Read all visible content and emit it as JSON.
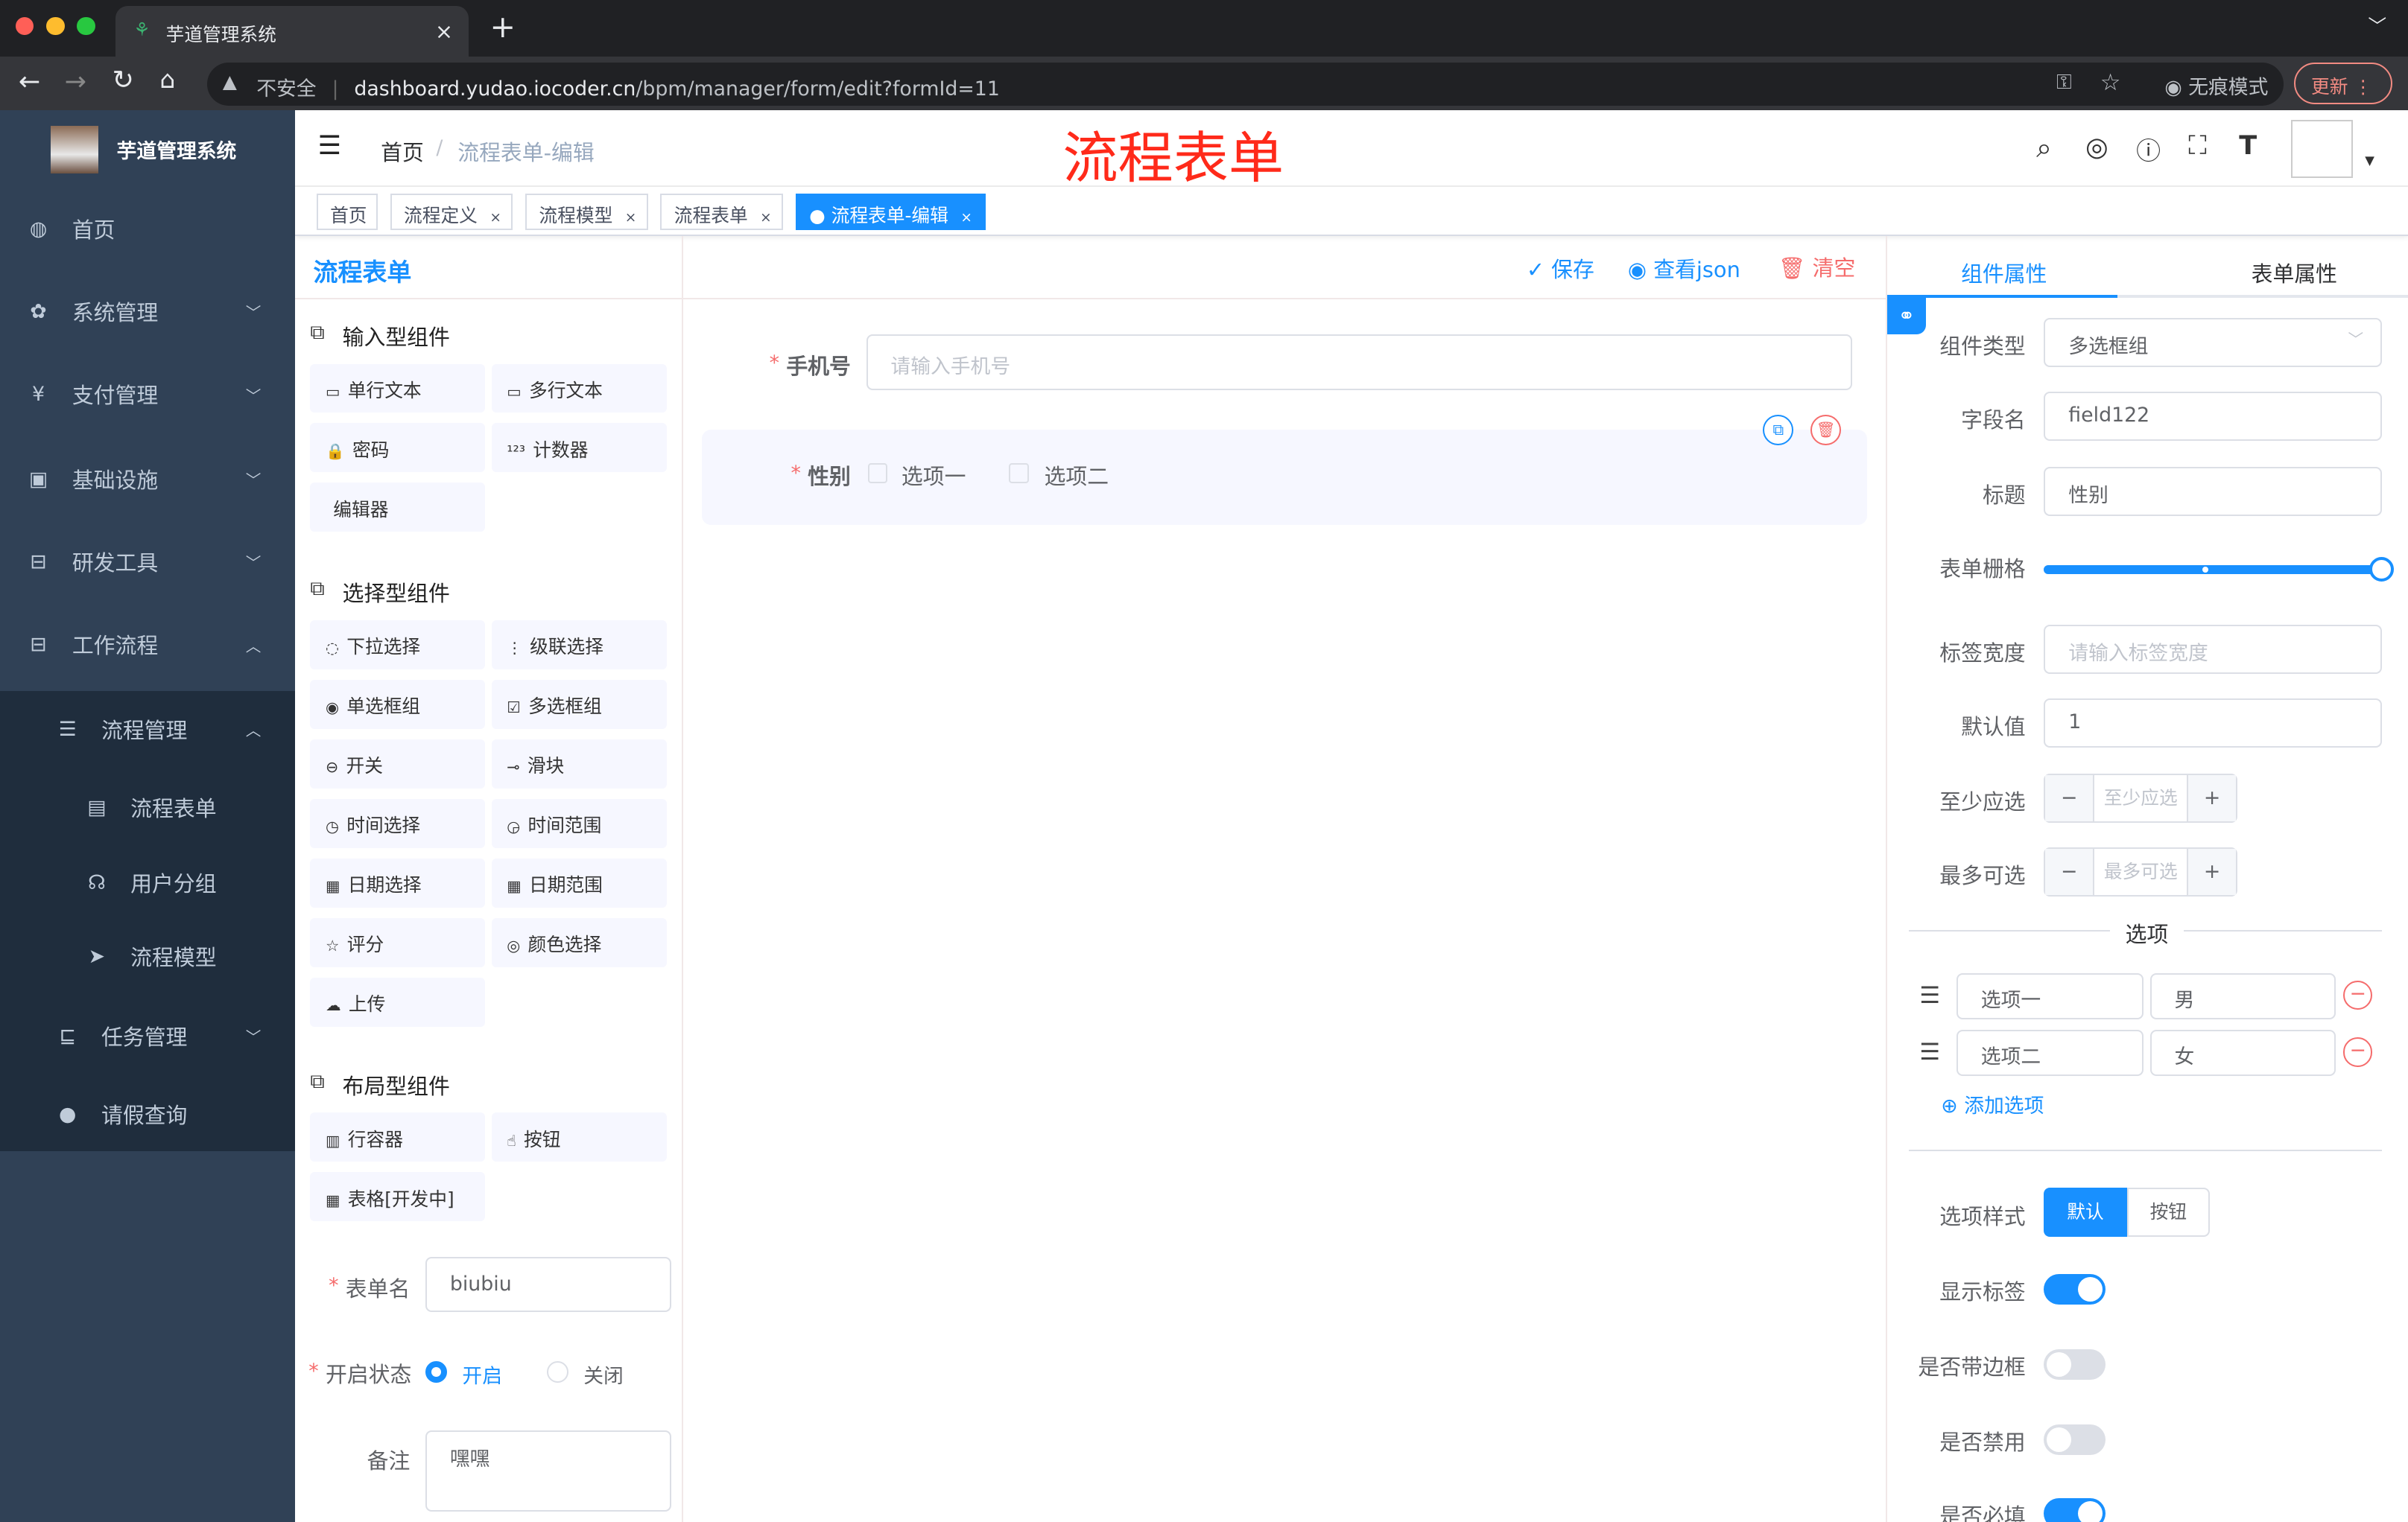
{
  "browser": {
    "tab_title": "芋道管理系统",
    "new_tab": "+",
    "close": "×",
    "insecure": "不安全",
    "url_host": "dashboard.yudao.iocoder.cn",
    "url_path": "/bpm/manager/form/edit?formId=11",
    "incognito": "无痕模式",
    "update": "更新"
  },
  "sidebar": {
    "title": "芋道管理系统",
    "items": [
      {
        "label": "首页",
        "icon": "dashboard-icon",
        "glyph": "◍",
        "level": 0
      },
      {
        "label": "系统管理",
        "icon": "gear-icon",
        "glyph": "✿",
        "level": 0,
        "chev": "﹀"
      },
      {
        "label": "支付管理",
        "icon": "yen-icon",
        "glyph": "¥",
        "level": 0,
        "chev": "﹀"
      },
      {
        "label": "基础设施",
        "icon": "monitor-icon",
        "glyph": "▣",
        "level": 0,
        "chev": "﹀"
      },
      {
        "label": "研发工具",
        "icon": "toolbox-icon",
        "glyph": "⊟",
        "level": 0,
        "chev": "﹀"
      },
      {
        "label": "工作流程",
        "icon": "workflow-icon",
        "glyph": "⊟",
        "level": 0,
        "chev": "︿"
      },
      {
        "label": "流程管理",
        "icon": "tree-icon",
        "glyph": "☰",
        "level": 1,
        "chev": "︿"
      },
      {
        "label": "流程表单",
        "icon": "form-icon",
        "glyph": "▤",
        "level": 2
      },
      {
        "label": "用户分组",
        "icon": "group-icon",
        "glyph": "☊",
        "level": 2
      },
      {
        "label": "流程模型",
        "icon": "send-icon",
        "glyph": "➤",
        "level": 2
      },
      {
        "label": "任务管理",
        "icon": "task-icon",
        "glyph": "⊑",
        "level": 1,
        "chev": "﹀"
      },
      {
        "label": "请假查询",
        "icon": "user-icon",
        "glyph": "●",
        "level": 1
      }
    ]
  },
  "header": {
    "breadcrumb": [
      "首页",
      "流程表单-编辑"
    ],
    "title": "流程表单"
  },
  "tags": [
    {
      "label": "首页"
    },
    {
      "label": "流程定义",
      "close": "×"
    },
    {
      "label": "流程模型",
      "close": "×"
    },
    {
      "label": "流程表单",
      "close": "×"
    },
    {
      "label": "流程表单-编辑",
      "close": "×",
      "active": true
    }
  ],
  "left": {
    "title": "流程表单",
    "groups": [
      {
        "title": "输入型组件",
        "items": [
          "单行文本",
          "多行文本",
          "密码",
          "计数器",
          "编辑器"
        ]
      },
      {
        "title": "选择型组件",
        "items": [
          "下拉选择",
          "级联选择",
          "单选框组",
          "多选框组",
          "开关",
          "滑块",
          "时间选择",
          "时间范围",
          "日期选择",
          "日期范围",
          "评分",
          "颜色选择",
          "上传"
        ]
      },
      {
        "title": "布局型组件",
        "items": [
          "行容器",
          "按钮",
          "表格[开发中]"
        ]
      }
    ],
    "form_name_label": "表单名",
    "form_name": "biubiu",
    "status_label": "开启状态",
    "status_on": "开启",
    "status_off": "关闭",
    "remark_label": "备注",
    "remark": "嘿嘿"
  },
  "toolbar": {
    "save": "保存",
    "json": "查看json",
    "clear": "清空"
  },
  "canvas": {
    "phone_label": "手机号",
    "phone_placeholder": "请输入手机号",
    "gender_label": "性别",
    "options": [
      "选项一",
      "选项二"
    ]
  },
  "props": {
    "tabs": [
      "组件属性",
      "表单属性"
    ],
    "type_label": "组件类型",
    "type_value": "多选框组",
    "field_label": "字段名",
    "field_value": "field122",
    "title_label": "标题",
    "title_value": "性别",
    "grid_label": "表单栅格",
    "grid_value": 24,
    "grid_max": 24,
    "label_width_label": "标签宽度",
    "label_width_placeholder": "请输入标签宽度",
    "default_label": "默认值",
    "default_value": "1",
    "min_label": "至少应选",
    "min_placeholder": "至少应选",
    "max_label": "最多可选",
    "max_placeholder": "最多可选",
    "options_title": "选项",
    "options": [
      {
        "label": "选项一",
        "value": "男"
      },
      {
        "label": "选项二",
        "value": "女"
      }
    ],
    "add_option": "添加选项",
    "style_label": "选项样式",
    "style_options": [
      "默认",
      "按钮"
    ],
    "show_label": "显示标签",
    "show_label_on": true,
    "border_label": "是否带边框",
    "border_on": false,
    "disabled_label": "是否禁用",
    "disabled_on": false,
    "required_label": "是否必填",
    "required_on": true
  },
  "colors": {
    "primary": "#1890ff",
    "sidebar": "#304156",
    "danger": "#f56c6c",
    "title_red": "#ff2a1a"
  }
}
